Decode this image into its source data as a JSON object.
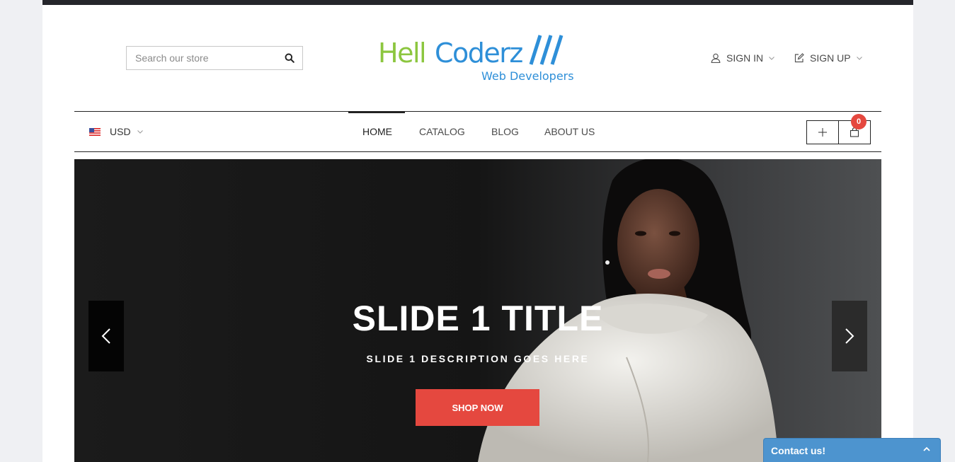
{
  "search": {
    "placeholder": "Search our store",
    "icon": "search-icon"
  },
  "logo": {
    "word1": "Hell",
    "word2": "Coderz",
    "slashes": "///",
    "tagline": "Web Developers",
    "color_green": "#8cc63f",
    "color_blue": "#2e8fd8"
  },
  "account": {
    "sign_in": "SIGN IN",
    "sign_up": "SIGN UP"
  },
  "currency": {
    "selected": "USD",
    "flag": "us-flag-icon"
  },
  "nav": {
    "items": [
      {
        "label": "HOME",
        "active": true
      },
      {
        "label": "CATALOG",
        "active": false
      },
      {
        "label": "BLOG",
        "active": false
      },
      {
        "label": "ABOUT US",
        "active": false
      }
    ]
  },
  "cart": {
    "count": "0"
  },
  "slider": {
    "title": "SLIDE 1 TITLE",
    "description": "SLIDE 1 DESCRIPTION GOES HERE",
    "button": "SHOP NOW",
    "accent": "#e5483f"
  },
  "contact": {
    "label": "Contact us!",
    "color": "#4d94cf"
  }
}
